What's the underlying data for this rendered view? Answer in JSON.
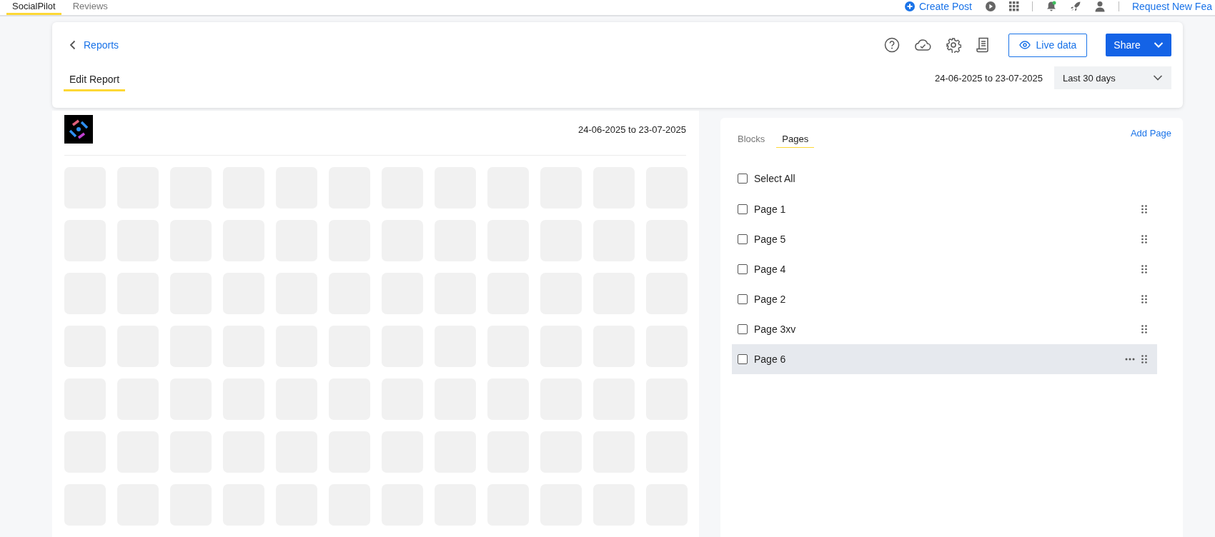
{
  "top_tabs": [
    {
      "label": "SocialPilot",
      "selected": true
    },
    {
      "label": "Reviews",
      "selected": false
    }
  ],
  "top_actions": {
    "create_post": "Create Post",
    "notification_dot": true,
    "request_link": "Request New Fea"
  },
  "header": {
    "back_link": "Reports",
    "tabs": [
      {
        "label": "Edit Report",
        "selected": true
      }
    ],
    "live_data": "Live data",
    "share": "Share",
    "date_range": "24-06-2025 to 23-07-2025",
    "period": "Last 30 days"
  },
  "report": {
    "date_range": "24-06-2025 to 23-07-2025"
  },
  "side_panel": {
    "tabs": [
      {
        "label": "Blocks",
        "selected": false
      },
      {
        "label": "Pages",
        "selected": true
      }
    ],
    "add_page": "Add Page",
    "select_all": {
      "label": "Select All",
      "checked": false
    },
    "pages": [
      {
        "label": "Page 1",
        "checked": false,
        "hovered": false
      },
      {
        "label": "Page 5",
        "checked": false,
        "hovered": false
      },
      {
        "label": "Page 4",
        "checked": false,
        "hovered": false
      },
      {
        "label": "Page 2",
        "checked": false,
        "hovered": false
      },
      {
        "label": "Page 3xv",
        "checked": false,
        "hovered": false
      },
      {
        "label": "Page 6",
        "checked": false,
        "hovered": true
      }
    ]
  }
}
